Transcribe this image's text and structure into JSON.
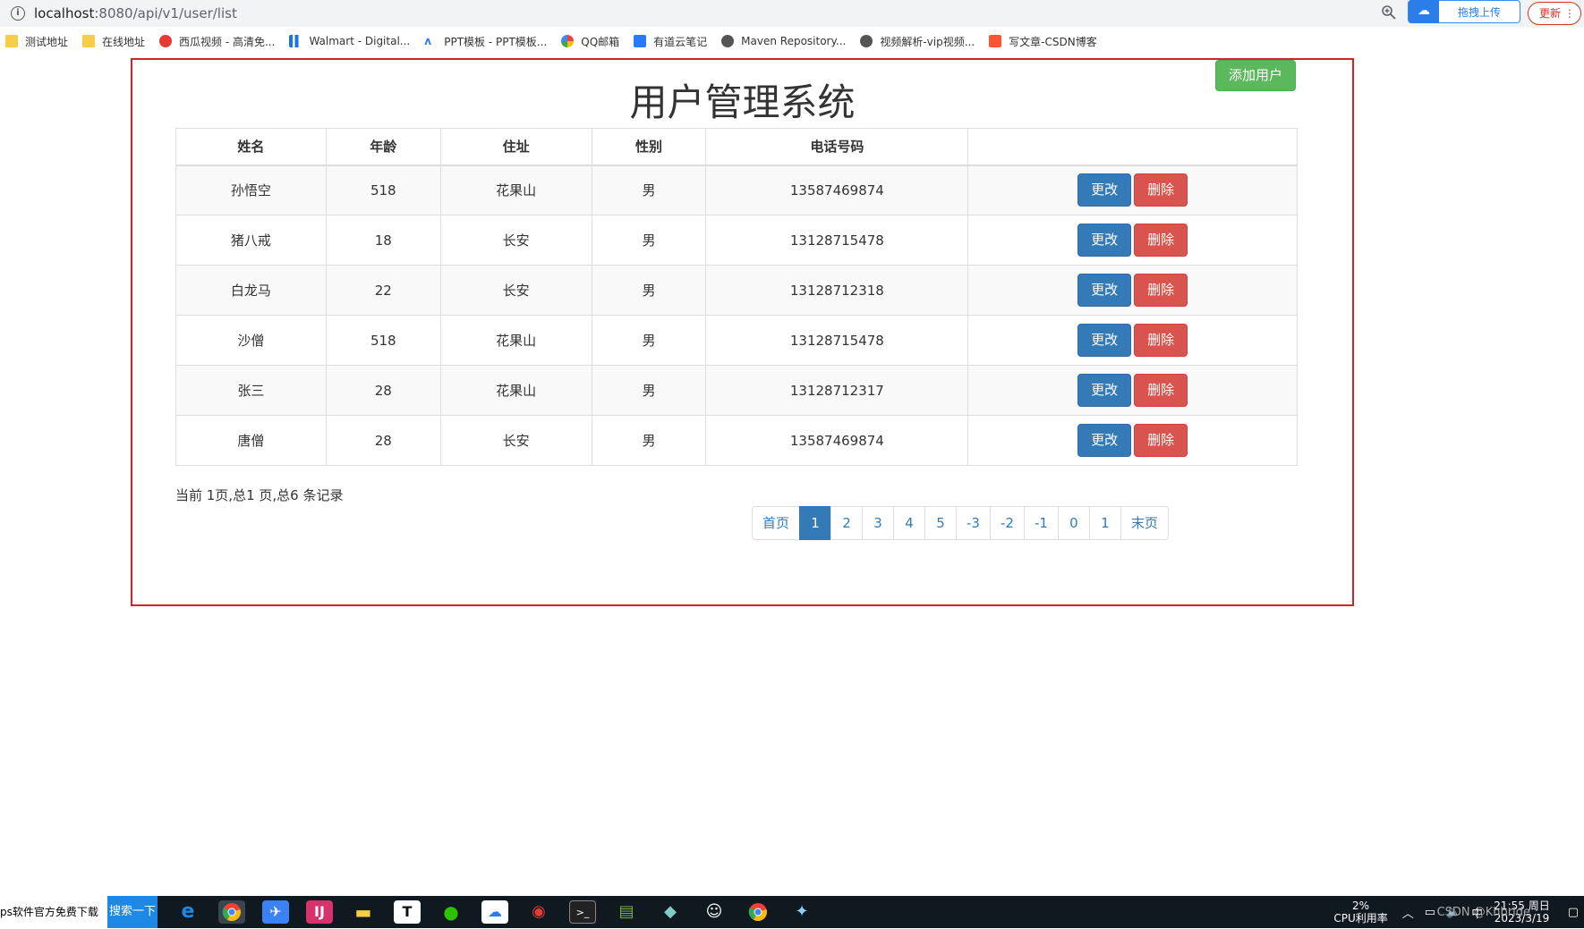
{
  "browser": {
    "url_host": "localhost",
    "url_path": ":8080/api/v1/user/list",
    "upload_ext_label": "拖拽上传",
    "update_label": "更新",
    "bookmarks": [
      {
        "label": "测试地址",
        "icon": "folder-icon"
      },
      {
        "label": "在线地址",
        "icon": "folder-icon"
      },
      {
        "label": "西瓜视频 - 高清免...",
        "icon": "xigua-icon"
      },
      {
        "label": "Walmart - Digital...",
        "icon": "walmart-icon"
      },
      {
        "label": "PPT模板 - PPT模板...",
        "icon": "ppt-icon"
      },
      {
        "label": "QQ邮箱",
        "icon": "qq-mail-icon"
      },
      {
        "label": "有道云笔记",
        "icon": "youdao-icon"
      },
      {
        "label": "Maven Repository...",
        "icon": "globe-icon"
      },
      {
        "label": "视频解析-vip视频...",
        "icon": "globe-icon"
      },
      {
        "label": "写文章-CSDN博客",
        "icon": "csdn-icon"
      }
    ]
  },
  "page": {
    "title": "用户管理系统",
    "add_button": "添加用户",
    "columns": [
      "姓名",
      "年龄",
      "住址",
      "性别",
      "电话号码",
      ""
    ],
    "rows": [
      {
        "name": "孙悟空",
        "age": "518",
        "address": "花果山",
        "gender": "男",
        "phone": "13587469874"
      },
      {
        "name": "猪八戒",
        "age": "18",
        "address": "长安",
        "gender": "男",
        "phone": "13128715478"
      },
      {
        "name": "白龙马",
        "age": "22",
        "address": "长安",
        "gender": "男",
        "phone": "13128712318"
      },
      {
        "name": "沙僧",
        "age": "518",
        "address": "花果山",
        "gender": "男",
        "phone": "13128715478"
      },
      {
        "name": "张三",
        "age": "28",
        "address": "花果山",
        "gender": "男",
        "phone": "13128712317"
      },
      {
        "name": "唐僧",
        "age": "28",
        "address": "长安",
        "gender": "男",
        "phone": "13587469874"
      }
    ],
    "edit_label": "更改",
    "delete_label": "删除",
    "page_info": "当前 1页,总1 页,总6 条记录",
    "pagination": [
      "首页",
      "1",
      "2",
      "3",
      "4",
      "5",
      "-3",
      "-2",
      "-1",
      "0",
      "1",
      "末页"
    ],
    "active_page_index": 1
  },
  "taskbar": {
    "search_text": "ps软件官方免费下载",
    "search_button": "搜索一下",
    "cpu_percent": "2%",
    "cpu_label": "CPU利用率",
    "time": "21:55 周日",
    "date": "2023/3/19",
    "watermark": "CSDN @Khbride"
  }
}
